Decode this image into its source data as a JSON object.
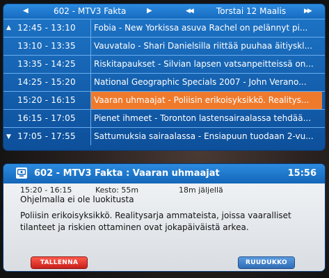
{
  "epg": {
    "channel": "602 - MTV3 Fakta",
    "date": "Torstai 12 Maalis",
    "icons": {
      "prev_channel": "triangle-left-icon",
      "next_channel": "triangle-right-icon",
      "prev_day": "double-chevron-left-icon",
      "next_day": "double-chevron-right-icon",
      "scroll_up": "scroll-up-icon",
      "scroll_down": "scroll-down-icon"
    },
    "programs": [
      {
        "time": "12:45 - 13:10",
        "title": "Fobia - New Yorkissa asuva Rachel on pelännyt pi..."
      },
      {
        "time": "13:10 - 13:35",
        "title": "Vauvatalo - Shari Danielsilla riittää puuhaa äitiyskl..."
      },
      {
        "time": "13:35 - 14:25",
        "title": "Riskitapaukset - Silvian lapsen vatsanpeitteissä on..."
      },
      {
        "time": "14:25 - 15:20",
        "title": "National Geographic Specials 2007 - John Verano..."
      },
      {
        "time": "15:20 - 16:15",
        "title": "Vaaran uhmaajat - Poliisin erikoisyksikkö. Realitys..."
      },
      {
        "time": "16:15 - 17:05",
        "title": "Pienet ihmeet - Toronton lastensairaalassa tehdää..."
      },
      {
        "time": "17:05 - 17:55",
        "title": "Sattumuksia sairaalassa - Ensiapuun tuodaan 2-vu..."
      }
    ],
    "selected_index": 4
  },
  "info": {
    "title": "602 - MTV3 Fakta : Vaaran uhmaajat",
    "clock": "15:56",
    "time_range": "15:20 - 16:15",
    "duration": "Kesto: 55m",
    "remaining": "18m jäljellä",
    "rating": "Ohjelmalla ei ole luokitusta",
    "description": "Poliisin erikoisyksikkö. Realitysarja ammateista, joissa vaaralliset tilanteet ja riskien ottaminen ovat jokapäiväistä arkea.",
    "icon": "tv-icon"
  },
  "buttons": {
    "record": "TALLENNA",
    "grid": "RUUDUKKO"
  },
  "colors": {
    "panel_blue": "#1e76c8",
    "selected_orange": "#f07a2c",
    "record_red": "#e03020",
    "grid_blue": "#4a86cc"
  }
}
